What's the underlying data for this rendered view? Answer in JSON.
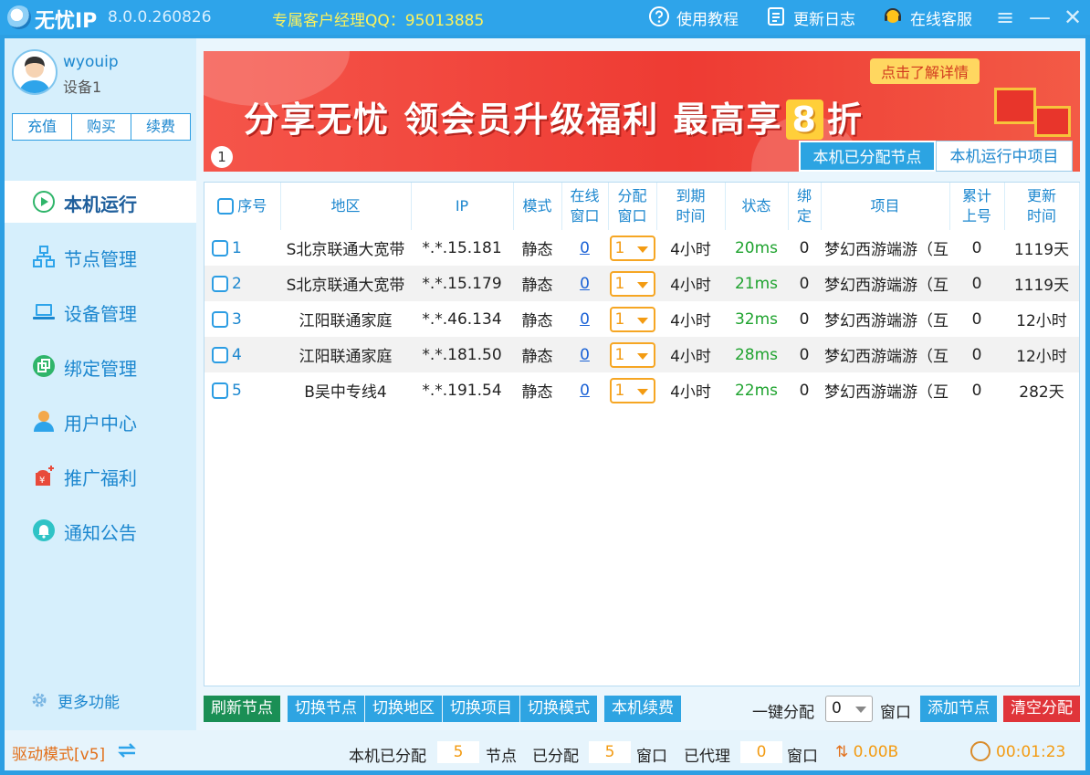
{
  "titlebar": {
    "app_name": "无忧IP",
    "version": "8.0.0.260826",
    "qq_label": "专属客户经理QQ：95013885",
    "tutorial": "使用教程",
    "changelog": "更新日志",
    "support": "在线客服"
  },
  "user": {
    "name": "wyouip",
    "device": "设备1",
    "buttons": [
      "充值",
      "购买",
      "续费"
    ]
  },
  "nav": [
    {
      "label": "本机运行",
      "icon": "play-circle-icon",
      "active": true
    },
    {
      "label": "节点管理",
      "icon": "network-icon"
    },
    {
      "label": "设备管理",
      "icon": "laptop-icon"
    },
    {
      "label": "绑定管理",
      "icon": "copy-icon"
    },
    {
      "label": "用户中心",
      "icon": "user-icon"
    },
    {
      "label": "推广福利",
      "icon": "gift-money-icon"
    },
    {
      "label": "通知公告",
      "icon": "bell-icon"
    }
  ],
  "more_label": "更多功能",
  "banner": {
    "text_before": "分享无忧 领会员升级福利 最高享",
    "highlight": "8",
    "text_after": "折",
    "cta": "点击了解详情",
    "page": "1"
  },
  "tabs": [
    "本机已分配节点",
    "本机运行中项目"
  ],
  "table": {
    "headers": [
      "序号",
      "地区",
      "IP",
      "模式",
      "在线\n窗口",
      "分配\n窗口",
      "到期\n时间",
      "状态",
      "绑\n定",
      "项目",
      "累计\n上号",
      "更新\n时间"
    ],
    "rows": [
      {
        "seq": "1",
        "region": "S北京联通大宽带",
        "ip": "*.*.15.181",
        "mode": "静态",
        "online": "0",
        "alloc": "1",
        "expire": "4小时",
        "status": "20ms",
        "bind": "0",
        "project": "梦幻西游端游（互",
        "total": "0",
        "update": "1119天"
      },
      {
        "seq": "2",
        "region": "S北京联通大宽带",
        "ip": "*.*.15.179",
        "mode": "静态",
        "online": "0",
        "alloc": "1",
        "expire": "4小时",
        "status": "21ms",
        "bind": "0",
        "project": "梦幻西游端游（互",
        "total": "0",
        "update": "1119天"
      },
      {
        "seq": "3",
        "region": "江阳联通家庭",
        "ip": "*.*.46.134",
        "mode": "静态",
        "online": "0",
        "alloc": "1",
        "expire": "4小时",
        "status": "32ms",
        "bind": "0",
        "project": "梦幻西游端游（互",
        "total": "0",
        "update": "12小时"
      },
      {
        "seq": "4",
        "region": "江阳联通家庭",
        "ip": "*.*.181.50",
        "mode": "静态",
        "online": "0",
        "alloc": "1",
        "expire": "4小时",
        "status": "28ms",
        "bind": "0",
        "project": "梦幻西游端游（互",
        "total": "0",
        "update": "12小时"
      },
      {
        "seq": "5",
        "region": "B吴中专线4",
        "ip": "*.*.191.54",
        "mode": "静态",
        "online": "0",
        "alloc": "1",
        "expire": "4小时",
        "status": "22ms",
        "bind": "0",
        "project": "梦幻西游端游（互",
        "total": "0",
        "update": "282天"
      }
    ]
  },
  "actions": {
    "refresh": "刷新节点",
    "switch_node": "切换节点",
    "switch_region": "切换地区",
    "switch_project": "切换项目",
    "switch_mode": "切换模式",
    "renew_local": "本机续费",
    "onekey_label": "一键分配",
    "onekey_value": "0",
    "window_label": "窗口",
    "add_node": "添加节点",
    "clear_alloc": "清空分配"
  },
  "statusbar": {
    "driver_mode": "驱动模式[v5]",
    "local_alloc_label": "本机已分配",
    "local_alloc_value": "5",
    "node_label": "节点",
    "alloc_label": "已分配",
    "alloc_value": "5",
    "window_label": "窗口",
    "proxy_label": "已代理",
    "proxy_value": "0",
    "window_label2": "窗口",
    "traffic": "0.00B",
    "timer": "00:01:23"
  },
  "colors": {
    "accent": "#2ea4ea",
    "status_ok": "#1fa32f",
    "warning_orange": "#f39b12",
    "danger_red": "#e0353a",
    "green_button": "#1a8f55"
  }
}
